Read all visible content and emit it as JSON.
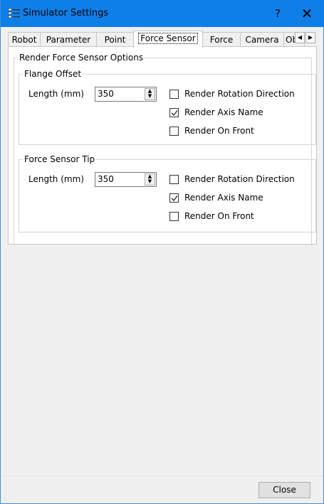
{
  "window": {
    "title": "Simulator Settings",
    "help_symbol": "?",
    "close_symbol": "✕",
    "accent_color": "#0f7fe8"
  },
  "tabs": [
    {
      "label": "Robot",
      "active": false
    },
    {
      "label": "Parameter",
      "active": false
    },
    {
      "label": "Point",
      "active": false
    },
    {
      "label": "Force Sensor",
      "active": true
    },
    {
      "label": "Force",
      "active": false
    },
    {
      "label": "Camera",
      "active": false
    },
    {
      "label": "Ob",
      "active": false
    }
  ],
  "tab_scroll": {
    "left_icon": "◀",
    "right_icon": "▶"
  },
  "panel": {
    "group_title": "Render Force Sensor Options",
    "flange_offset": {
      "title": "Flange Offset",
      "length_label": "Length (mm)",
      "length_value": "350",
      "options": [
        {
          "label": "Render Rotation Direction",
          "checked": false
        },
        {
          "label": "Render Axis Name",
          "checked": true
        },
        {
          "label": "Render On Front",
          "checked": false
        }
      ]
    },
    "force_sensor_tip": {
      "title": "Force Sensor Tip",
      "length_label": "Length (mm)",
      "length_value": "350",
      "options": [
        {
          "label": "Render Rotation Direction",
          "checked": false
        },
        {
          "label": "Render Axis Name",
          "checked": true
        },
        {
          "label": "Render On Front",
          "checked": false
        }
      ]
    }
  },
  "footer": {
    "close_label": "Close"
  }
}
